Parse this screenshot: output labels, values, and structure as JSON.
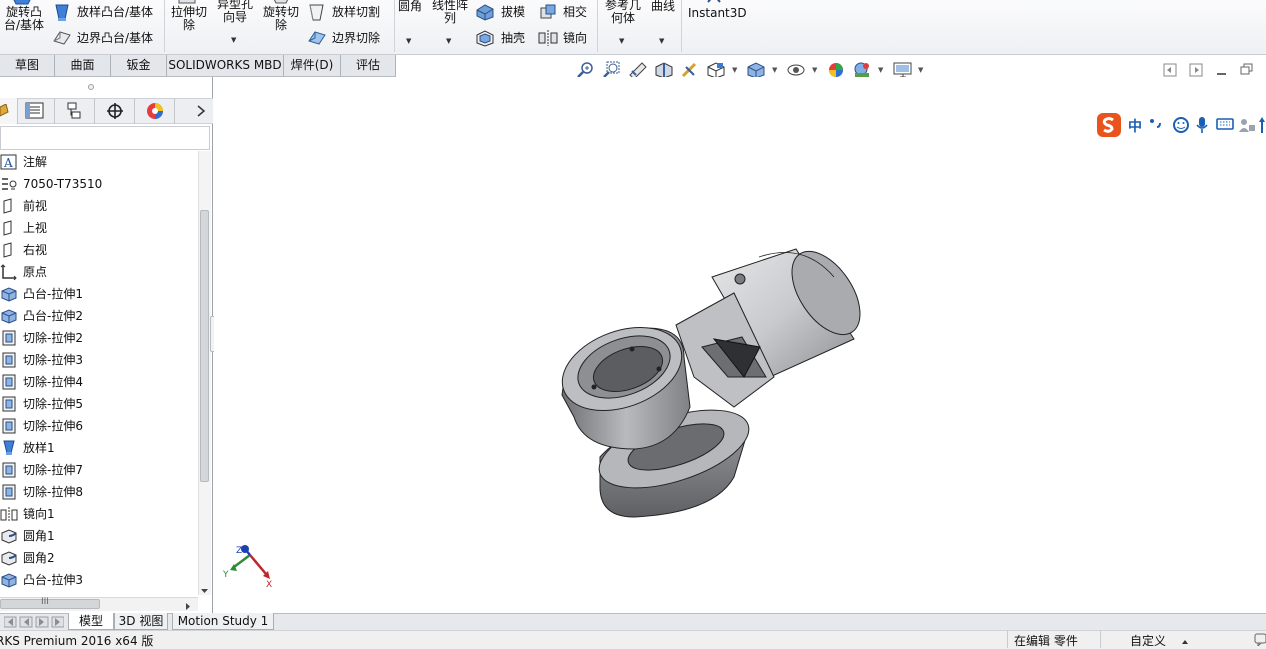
{
  "ribbon": {
    "revolve_boss": "旋转凸\n台/基体",
    "loft_boss": "放样凸台/基体",
    "boundary_boss": "边界凸台/基体",
    "extrude_cut": "拉伸切\n除",
    "hole_wizard": "异型孔\n向导",
    "revolve_cut": "旋转切\n除",
    "loft_cut": "放样切割",
    "boundary_cut": "边界切除",
    "fillet": "圆角",
    "linear_pattern": "线性阵\n列",
    "draft": "拔模",
    "intersect": "相交",
    "shell": "抽壳",
    "mirror": "镜向",
    "ref_geometry": "参考几\n何体",
    "curves": "曲线",
    "instant3d": "Instant3D"
  },
  "cm_tabs": [
    "草图",
    "曲面",
    "钣金",
    "SOLIDWORKS MBD",
    "焊件(D)",
    "评估"
  ],
  "tree": [
    {
      "label": "注解",
      "icon": "annotations-icon"
    },
    {
      "label": "7050-T73510",
      "icon": "material-icon"
    },
    {
      "label": "前视",
      "icon": "plane-icon"
    },
    {
      "label": "上视",
      "icon": "plane-icon"
    },
    {
      "label": "右视",
      "icon": "plane-icon"
    },
    {
      "label": "原点",
      "icon": "origin-icon"
    },
    {
      "label": "凸台-拉伸1",
      "icon": "boss-extrude-icon"
    },
    {
      "label": "凸台-拉伸2",
      "icon": "boss-extrude-icon"
    },
    {
      "label": "切除-拉伸2",
      "icon": "cut-extrude-icon"
    },
    {
      "label": "切除-拉伸3",
      "icon": "cut-extrude-icon"
    },
    {
      "label": "切除-拉伸4",
      "icon": "cut-extrude-icon"
    },
    {
      "label": "切除-拉伸5",
      "icon": "cut-extrude-icon"
    },
    {
      "label": "切除-拉伸6",
      "icon": "cut-extrude-icon"
    },
    {
      "label": "放样1",
      "icon": "loft-icon"
    },
    {
      "label": "切除-拉伸7",
      "icon": "cut-extrude-icon"
    },
    {
      "label": "切除-拉伸8",
      "icon": "cut-extrude-icon"
    },
    {
      "label": "镜向1",
      "icon": "mirror-icon"
    },
    {
      "label": "圆角1",
      "icon": "fillet-icon"
    },
    {
      "label": "圆角2",
      "icon": "fillet-icon"
    },
    {
      "label": "凸台-拉伸3",
      "icon": "boss-extrude-icon"
    }
  ],
  "bottom_tabs": [
    "模型",
    "3D 视图",
    "Motion Study 1"
  ],
  "status": {
    "app_version": "RKS Premium 2016 x64 版",
    "editing": "在编辑 零件",
    "units": "自定义"
  },
  "ime": {
    "lang": "中"
  },
  "triad": {
    "x": "X",
    "y": "Y",
    "z": "Z"
  },
  "hscroll_label": "III",
  "colors": {
    "ribbon_bg": "#eef0f3",
    "panel_border": "#9ea3ab",
    "ime_orange": "#e8541c",
    "ime_blue": "#1a5fb4"
  }
}
